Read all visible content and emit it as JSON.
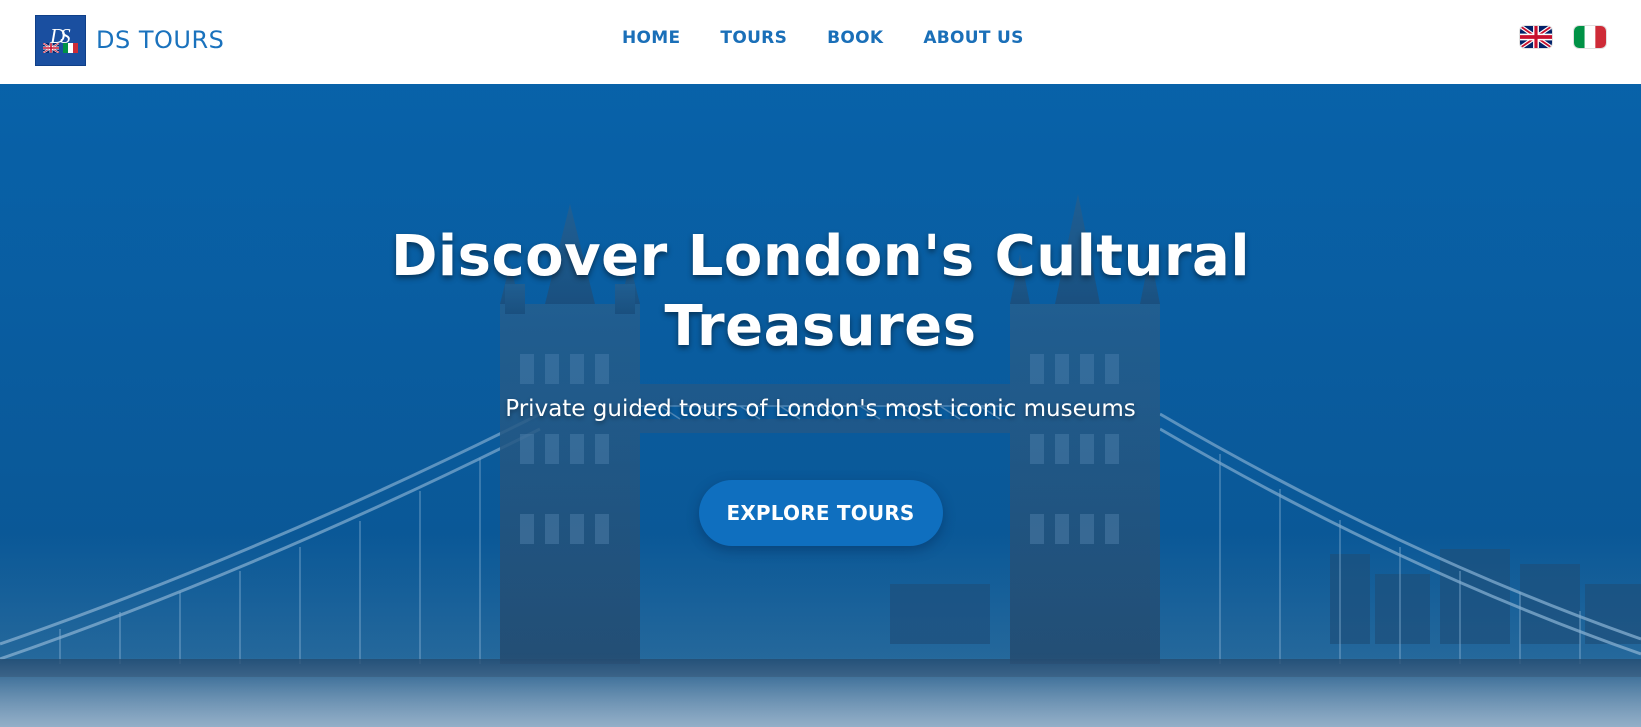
{
  "brand": {
    "logo_text": "DS",
    "name": "DS TOURS"
  },
  "nav": {
    "items": [
      {
        "label": "HOME"
      },
      {
        "label": "TOURS"
      },
      {
        "label": "BOOK"
      },
      {
        "label": "ABOUT US"
      }
    ]
  },
  "languages": [
    {
      "code": "en",
      "icon": "uk-flag-icon"
    },
    {
      "code": "it",
      "icon": "italy-flag-icon"
    }
  ],
  "hero": {
    "title": "Discover London's Cultural Treasures",
    "subtitle": "Private guided tours of London's most iconic museums",
    "cta_label": "EXPLORE TOURS",
    "background": "tower-bridge-image"
  },
  "colors": {
    "brand_blue": "#1a72bd",
    "hero_blue": "#0a5d9f",
    "cta_blue": "#0f6fbf"
  }
}
